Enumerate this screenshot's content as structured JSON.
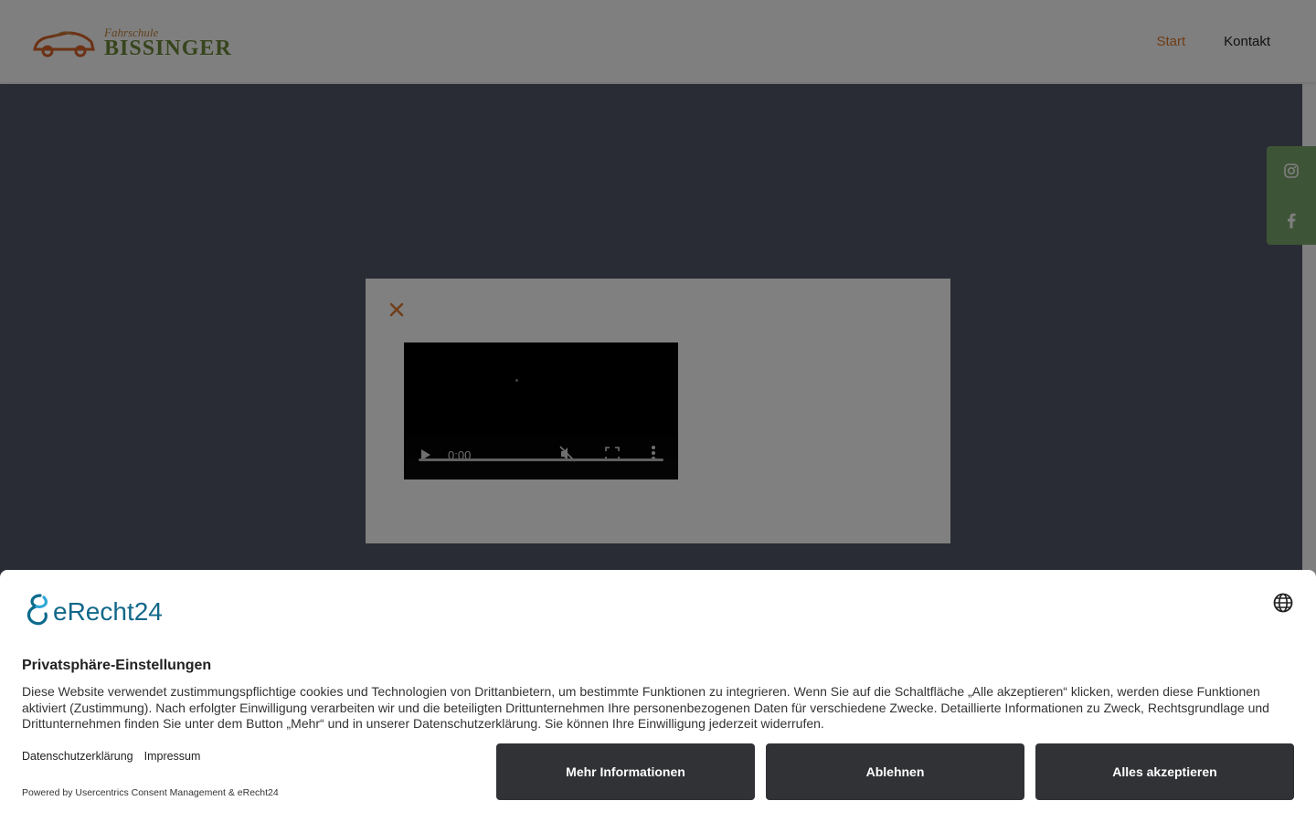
{
  "header": {
    "logo": {
      "small_text": "Fahrschule",
      "big_text": "BISSINGER"
    },
    "nav": [
      {
        "label": "Start",
        "active": true
      },
      {
        "label": "Kontakt",
        "active": false
      }
    ]
  },
  "social": [
    {
      "icon": "instagram-icon"
    },
    {
      "icon": "facebook-icon"
    }
  ],
  "lightbox": {
    "video": {
      "time": "0:00"
    }
  },
  "cookie": {
    "brand": "eRecht24",
    "title": "Privatsphäre-Einstellungen",
    "text": "Diese Website verwendet zustimmungspflichtige cookies und Technologien von Drittanbietern, um bestimmte Funktionen zu integrieren. Wenn Sie auf die Schaltfläche „Alle akzeptieren“ klicken, werden diese Funktionen aktiviert (Zustimmung). Nach erfolgter Einwilligung verarbeiten wir und die beteiligten Drittunternehmen Ihre personenbezogenen Daten für verschiedene Zwecke. Detaillierte Informationen zu Zweck, Rechtsgrundlage und Drittunternehmen finden Sie unter dem Button „Mehr“ und in unserer Datenschutzerklärung. Sie können Ihre Einwilligung jederzeit widerrufen.",
    "links": [
      "Datenschutzerklärung",
      "Impressum"
    ],
    "powered": "Powered by Usercentrics Consent Management & eRecht24",
    "buttons": {
      "more": "Mehr Informationen",
      "decline": "Ablehnen",
      "accept": "Alles akzeptieren"
    }
  },
  "colors": {
    "accent": "#e07a2e",
    "social_bg": "#7da86d",
    "button_bg": "#303235",
    "brand_blue": "#12688a"
  }
}
